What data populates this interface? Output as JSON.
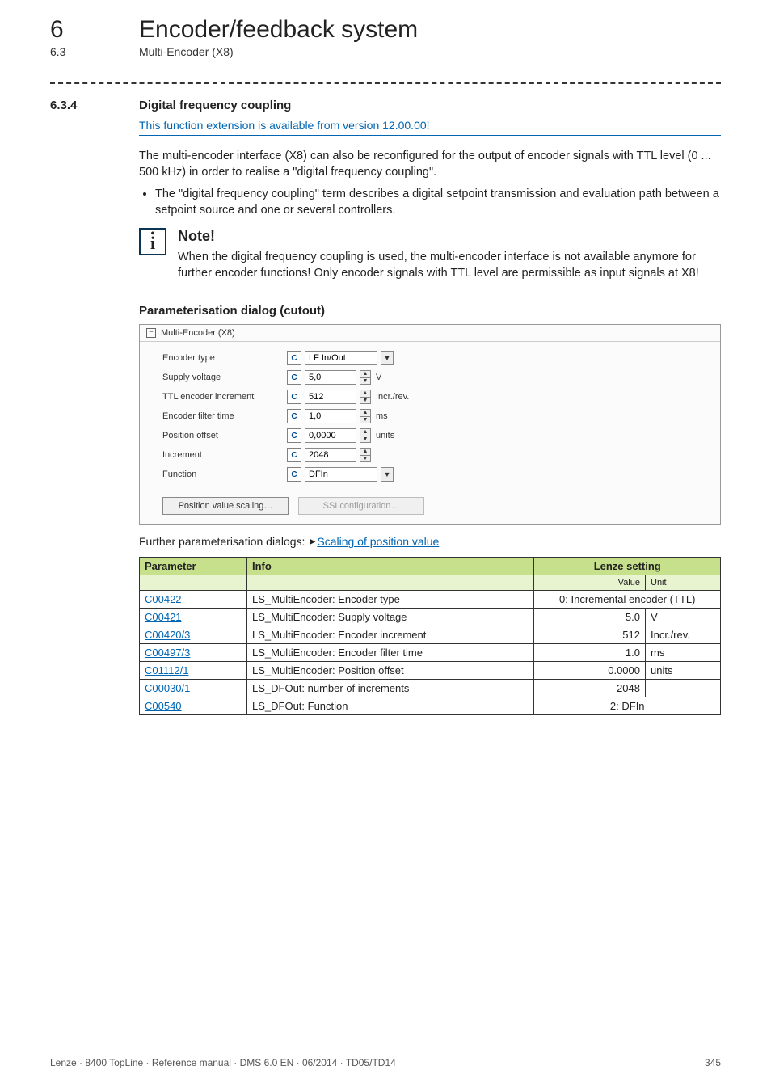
{
  "chapter": {
    "num": "6",
    "title": "Encoder/feedback system"
  },
  "section": {
    "num": "6.3",
    "title": "Multi-Encoder (X8)"
  },
  "subsection": {
    "num": "6.3.4",
    "title": "Digital frequency coupling",
    "version_note": "This function extension is available from version 12.00.00!"
  },
  "para1": "The multi-encoder interface (X8) can also be reconfigured for the output of encoder signals with TTL level (0 ... 500 kHz) in order to realise a \"digital frequency coupling\".",
  "bullet1": "The \"digital frequency coupling\" term describes a digital setpoint transmission and evaluation path between a setpoint source and one or several controllers.",
  "note": {
    "title": "Note!",
    "body": "When the digital frequency coupling is used, the multi-encoder interface is not available anymore for further encoder functions! Only encoder signals with TTL level are permissible as input signals at X8!"
  },
  "dialog_heading": "Parameterisation dialog (cutout)",
  "dialog": {
    "panel_title": "Multi-Encoder (X8)",
    "rows": [
      {
        "label": "Encoder type",
        "chip": "C",
        "control": "select",
        "value": "LF In/Out",
        "unit": ""
      },
      {
        "label": "Supply voltage",
        "chip": "C",
        "control": "spin",
        "value": "5,0",
        "unit": "V"
      },
      {
        "label": "TTL encoder increment",
        "chip": "C",
        "control": "spin",
        "value": "512",
        "unit": "Incr./rev."
      },
      {
        "label": "Encoder filter time",
        "chip": "C",
        "control": "spin",
        "value": "1,0",
        "unit": "ms"
      },
      {
        "label": "Position offset",
        "chip": "C",
        "control": "spin",
        "value": "0,0000",
        "unit": "units"
      },
      {
        "label": "Increment",
        "chip": "C",
        "control": "spin",
        "value": "2048",
        "unit": ""
      },
      {
        "label": "Function",
        "chip": "C",
        "control": "select",
        "value": "DFIn",
        "unit": ""
      }
    ],
    "buttons": {
      "pos_scaling": "Position value scaling…",
      "ssi_cfg": "SSI configuration…"
    }
  },
  "further": {
    "prefix": "Further parameterisation dialogs: ",
    "link": "Scaling of position value"
  },
  "param_table": {
    "headers": {
      "param": "Parameter",
      "info": "Info",
      "lenze": "Lenze setting",
      "value": "Value",
      "unit": "Unit"
    },
    "rows": [
      {
        "param": "C00422",
        "info": "LS_MultiEncoder: Encoder type",
        "value": "0: Incremental encoder (TTL)",
        "unit": "",
        "span": true
      },
      {
        "param": "C00421",
        "info": "LS_MultiEncoder: Supply voltage",
        "value": "5.0",
        "unit": "V"
      },
      {
        "param": "C00420/3",
        "info": "LS_MultiEncoder: Encoder increment",
        "value": "512",
        "unit": "Incr./rev."
      },
      {
        "param": "C00497/3",
        "info": "LS_MultiEncoder: Encoder filter time",
        "value": "1.0",
        "unit": "ms"
      },
      {
        "param": "C01112/1",
        "info": "LS_MultiEncoder: Position offset",
        "value": "0.0000",
        "unit": "units"
      },
      {
        "param": "C00030/1",
        "info": "LS_DFOut: number of increments",
        "value": "2048",
        "unit": ""
      },
      {
        "param": "C00540",
        "info": "LS_DFOut: Function",
        "value": "2: DFIn",
        "unit": "",
        "span": true
      }
    ]
  },
  "footer": {
    "left": "Lenze · 8400 TopLine · Reference manual · DMS 6.0 EN · 06/2014 · TD05/TD14",
    "right": "345"
  }
}
